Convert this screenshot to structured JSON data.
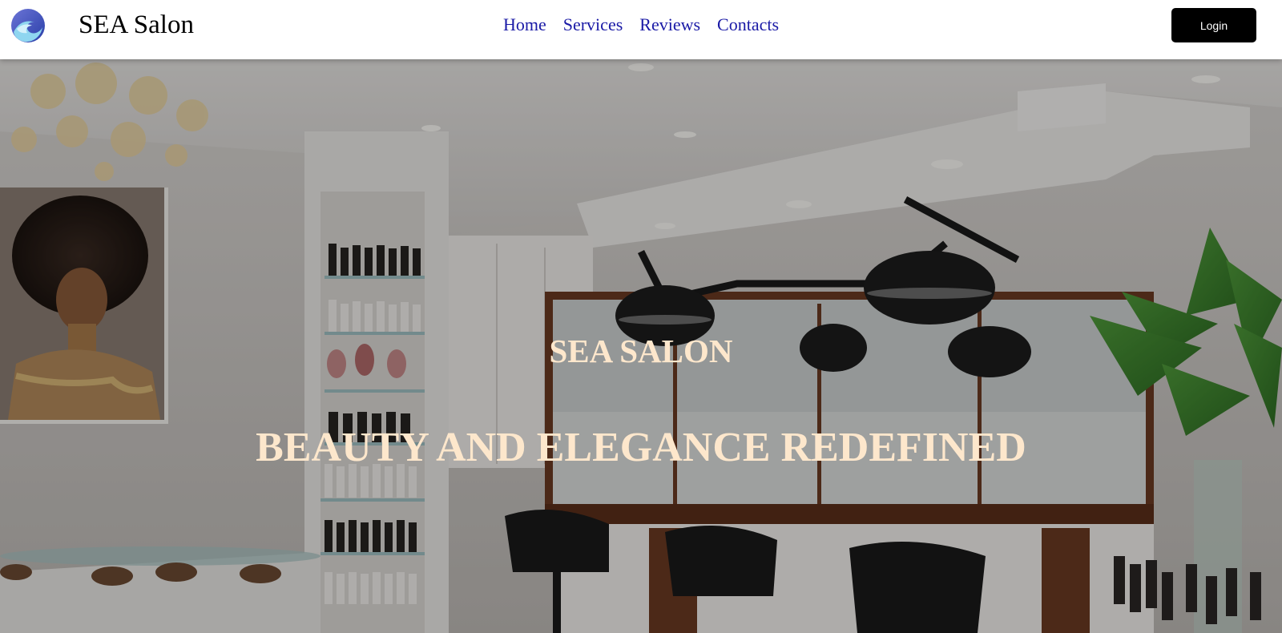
{
  "header": {
    "brand": "SEA Salon",
    "logo_icon": "wave-logo-icon",
    "nav": [
      {
        "label": "Home"
      },
      {
        "label": "Services"
      },
      {
        "label": "Reviews"
      },
      {
        "label": "Contacts"
      }
    ],
    "login_label": "Login"
  },
  "hero": {
    "subtitle": "SEA SALON",
    "title": "BEAUTY AND ELEGANCE REDEFINED",
    "background": "salon-interior-photo"
  },
  "colors": {
    "nav_link": "#1a1aa6",
    "hero_text": "#fde7cc",
    "login_bg": "#000000"
  }
}
